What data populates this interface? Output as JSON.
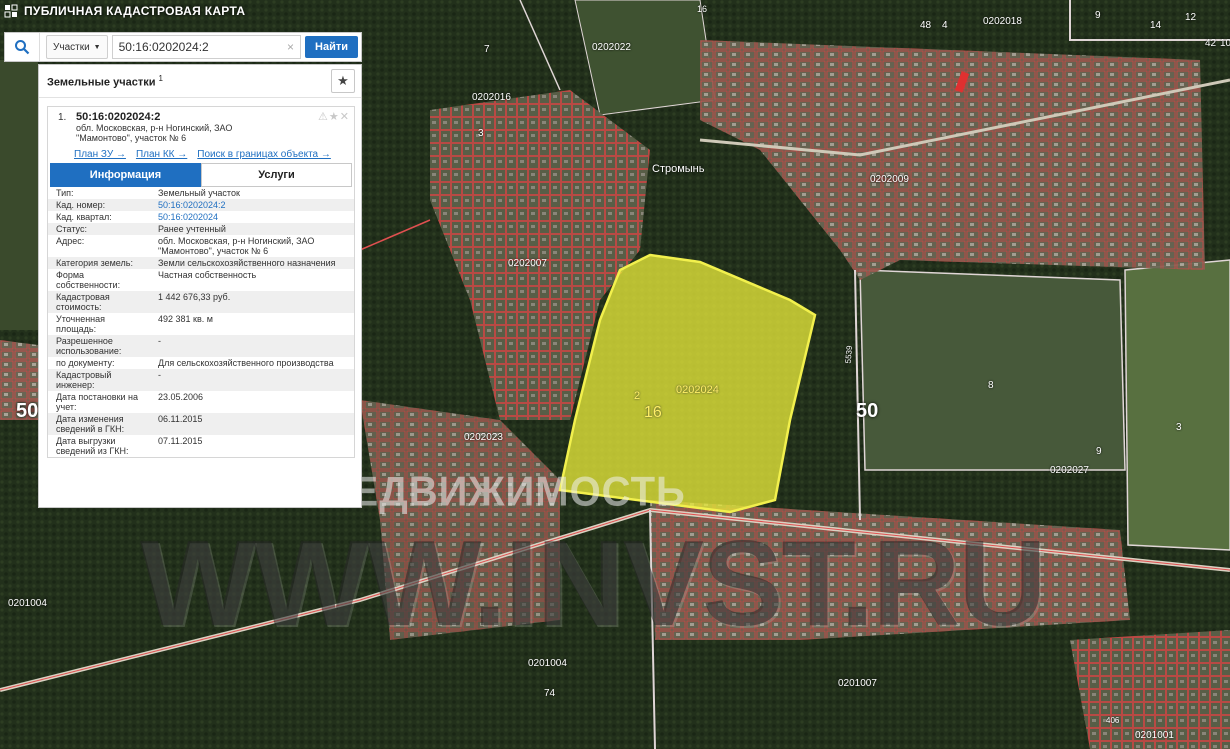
{
  "app": {
    "title": "ПУБЛИЧНАЯ КАДАСТРОВАЯ КАРТА"
  },
  "search": {
    "type_label": "Участки",
    "query": "50:16:0202024:2",
    "button_label": "Найти",
    "clear": "×"
  },
  "panel": {
    "title": "Земельные участки",
    "count": "1",
    "result": {
      "index": "1.",
      "code": "50:16:0202024:2",
      "address_line1": "обл. Московская, р-н Ногинский, ЗАО",
      "address_line2": "\"Мамонтово\", участок № 6",
      "links": [
        "План ЗУ →",
        "План КК →",
        "Поиск в границах объекта →"
      ]
    },
    "tabs": [
      "Информация",
      "Услуги"
    ],
    "rows": [
      {
        "k": "Тип:",
        "v": "Земельный участок"
      },
      {
        "k": "Кад. номер:",
        "v": "50:16:0202024:2",
        "link": true
      },
      {
        "k": "Кад. квартал:",
        "v": "50:16:0202024",
        "link": true
      },
      {
        "k": "Статус:",
        "v": "Ранее учтенный"
      },
      {
        "k": "Адрес:",
        "v": "обл. Московская, р-н Ногинский, ЗАО \"Мамонтово\", участок № 6"
      },
      {
        "k": "Категория земель:",
        "v": "Земли сельскохозяйственного назначения"
      },
      {
        "k": "Форма собственности:",
        "v": "Частная собственность"
      },
      {
        "k": "Кадастровая стоимость:",
        "v": "1 442 676,33 руб."
      },
      {
        "k": "Уточненная площадь:",
        "v": "492 381 кв. м"
      },
      {
        "k": "Разрешенное использование:",
        "v": "-"
      },
      {
        "k": "по документу:",
        "v": "Для сельскохозяйственного производства"
      },
      {
        "k": "Кадастровый инженер:",
        "v": "-"
      },
      {
        "k": "Дата постановки на учет:",
        "v": "23.05.2006"
      },
      {
        "k": "Дата изменения сведений в ГКН:",
        "v": "06.11.2015"
      },
      {
        "k": "Дата выгрузки сведений из ГКН:",
        "v": "07.11.2015"
      }
    ]
  },
  "map": {
    "labels": [
      {
        "t": "0202022"
      },
      {
        "t": "0202016"
      },
      {
        "t": "0202007"
      },
      {
        "t": "0202023"
      },
      {
        "t": "0202009"
      },
      {
        "t": "0202018"
      },
      {
        "t": "0202027"
      },
      {
        "t": "0201004"
      },
      {
        "t": "0201004"
      },
      {
        "t": "0201007"
      },
      {
        "t": "0201001"
      },
      {
        "t": "Стромынь"
      },
      {
        "t": "2"
      },
      {
        "t": "7"
      },
      {
        "t": "3"
      },
      {
        "t": "16"
      },
      {
        "t": "48"
      },
      {
        "t": "4"
      },
      {
        "t": "9"
      },
      {
        "t": "12"
      },
      {
        "t": "14"
      },
      {
        "t": "42"
      },
      {
        "t": "10"
      },
      {
        "t": "8"
      },
      {
        "t": "3"
      },
      {
        "t": "9"
      },
      {
        "t": "74"
      },
      {
        "t": "406"
      },
      {
        "t": "5539"
      }
    ],
    "region_labels": [
      "50",
      "50"
    ],
    "plot_labels": {
      "quarter": "0202024",
      "number": "2",
      "parcel": "16"
    }
  },
  "watermark": {
    "line1": "ИНВЕСТ НЕДВИЖИМОСТЬ",
    "line2": "WWW.INVST.RU"
  },
  "colors": {
    "accent": "#1f6fc1",
    "plot_fill": "#e6e83a",
    "boundary": "#e04a4a"
  },
  "icons": {
    "search": "magnifier-icon",
    "star": "star-icon",
    "logo": "map-logo-icon"
  }
}
